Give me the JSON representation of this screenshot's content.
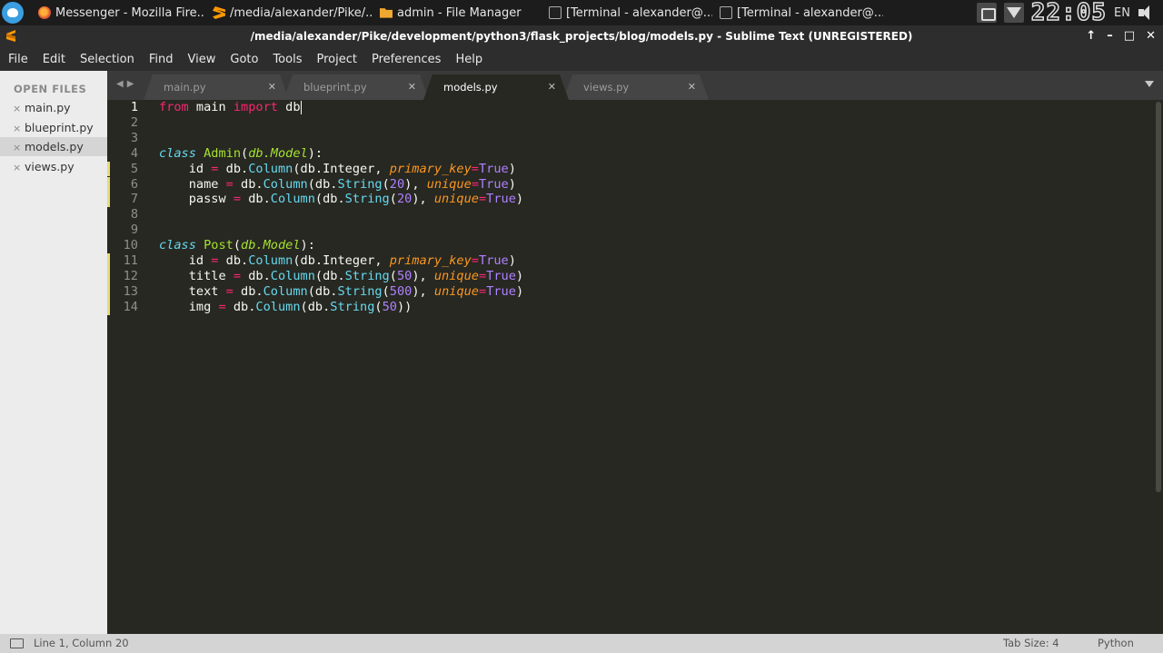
{
  "taskbar": {
    "tasks": [
      {
        "label": "Messenger - Mozilla Fire...",
        "icon": "firefox-icon"
      },
      {
        "label": "/media/alexander/Pike/...",
        "icon": "sublime-icon"
      },
      {
        "label": "admin - File Manager",
        "icon": "folder-icon"
      },
      {
        "label": "[Terminal - alexander@...",
        "icon": "terminal-icon"
      },
      {
        "label": "[Terminal - alexander@...",
        "icon": "terminal-icon"
      }
    ],
    "clock": "22:05",
    "language": "EN"
  },
  "window": {
    "title": "/media/alexander/Pike/development/python3/flask_projects/blog/models.py - Sublime Text (UNREGISTERED)",
    "controls": {
      "up": "↑",
      "minimize": "–",
      "maximize": "□",
      "close": "✕"
    }
  },
  "menu": [
    "File",
    "Edit",
    "Selection",
    "Find",
    "View",
    "Goto",
    "Tools",
    "Project",
    "Preferences",
    "Help"
  ],
  "sidebar": {
    "header": "OPEN FILES",
    "files": [
      {
        "name": "main.py",
        "active": false
      },
      {
        "name": "blueprint.py",
        "active": false
      },
      {
        "name": "models.py",
        "active": true
      },
      {
        "name": "views.py",
        "active": false
      }
    ]
  },
  "tabs": [
    {
      "label": "main.py",
      "active": false
    },
    {
      "label": "blueprint.py",
      "active": false
    },
    {
      "label": "models.py",
      "active": true
    },
    {
      "label": "views.py",
      "active": false
    }
  ],
  "editor": {
    "current_line": 1,
    "lines": [
      "from main import db",
      "",
      "",
      "class Admin(db.Model):",
      "    id = db.Column(db.Integer, primary_key=True)",
      "    name = db.Column(db.String(20), unique=True)",
      "    passw = db.Column(db.String(20), unique=True)",
      "",
      "",
      "class Post(db.Model):",
      "    id = db.Column(db.Integer, primary_key=True)",
      "    title = db.Column(db.String(50), unique=True)",
      "    text = db.Column(db.String(500), unique=True)",
      "    img = db.Column(db.String(50))"
    ],
    "modified_lines": [
      5,
      6,
      7,
      11,
      12,
      13,
      14
    ]
  },
  "status": {
    "position": "Line 1, Column 20",
    "tab_size": "Tab Size: 4",
    "syntax": "Python"
  },
  "colors": {
    "keyword": "#f92672",
    "storage": "#66d9ef",
    "class_name": "#a6e22e",
    "number": "#ae81ff",
    "argument": "#fd971f",
    "background": "#272822"
  }
}
